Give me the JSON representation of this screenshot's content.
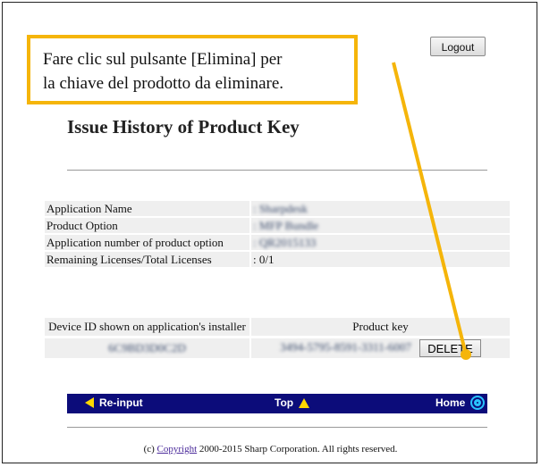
{
  "callout": {
    "line1": "Fare clic sul pulsante [Elimina] per",
    "line2": "la chiave del prodotto da eliminare."
  },
  "header": {
    "logout_label": "Logout",
    "title": "Issue History of Product Key"
  },
  "info": {
    "rows": [
      {
        "label": "Application Name",
        "value": ": Sharpdesk"
      },
      {
        "label": "Product Option",
        "value": ": MFP Bundle"
      },
      {
        "label": "Application number of product option",
        "value": ": QR2015133"
      },
      {
        "label": "Remaining Licenses/Total Licenses",
        "value": ": 0/1"
      }
    ]
  },
  "keys": {
    "col_device": "Device ID shown on application's installer",
    "col_key": "Product key",
    "device_id": "6C9BD3D0C2D",
    "product_key": "3494-5795-8591-3311-6007",
    "delete_label": "DELETE"
  },
  "nav": {
    "reinput_label": "Re-input",
    "top_label": "Top",
    "home_label": "Home"
  },
  "footer": {
    "prefix": "(c) ",
    "link": "Copyright",
    "suffix": " 2000-2015 Sharp Corporation. All rights reserved."
  },
  "colors": {
    "callout_border": "#f5b50a",
    "navbar_bg": "#0c0c7a",
    "nav_icon": "#ffd700"
  }
}
